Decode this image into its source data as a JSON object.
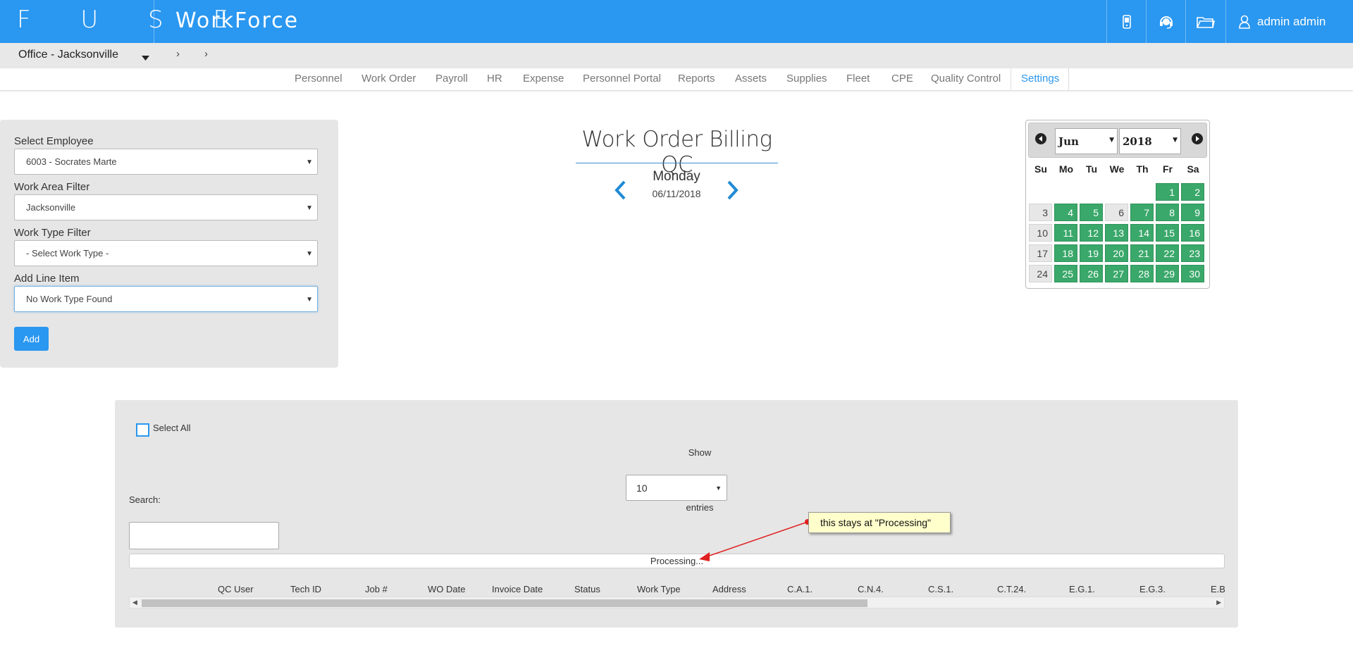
{
  "topbar": {
    "brand": "F U S E",
    "app_name": "WorkForce",
    "user_name": "admin admin",
    "icons": [
      "phone-icon",
      "headset-icon",
      "folder-icon",
      "user-icon"
    ],
    "color": "#2a97f0"
  },
  "officebar": {
    "office": "Office - Jacksonville",
    "crumbs": [
      "›",
      "›"
    ]
  },
  "nav": {
    "items": [
      "Personnel",
      "Work Order",
      "Payroll",
      "HR",
      "Expense",
      "Personnel Portal",
      "Reports",
      "Assets",
      "Supplies",
      "Fleet",
      "CPE",
      "Quality Control",
      "Settings"
    ],
    "active": "Settings"
  },
  "form": {
    "employee_label": "Select Employee",
    "employee_value": "6003 - Socrates Marte",
    "work_area_label": "Work Area Filter",
    "work_area_value": "Jacksonville",
    "work_type_label": "Work Type Filter",
    "work_type_value": "- Select Work Type -",
    "line_item_label": "Add Line Item",
    "line_item_value": "No Work Type Found",
    "add_label": "Add"
  },
  "header": {
    "title": "Work Order Billing QC",
    "day": "Monday",
    "date": "06/11/2018"
  },
  "calendar": {
    "month": "Jun",
    "year": "2018",
    "dow": [
      "Su",
      "Mo",
      "Tu",
      "We",
      "Th",
      "Fr",
      "Sa"
    ],
    "weeks": [
      [
        null,
        null,
        null,
        null,
        null,
        {
          "d": "1",
          "on": true
        },
        {
          "d": "2",
          "on": true
        }
      ],
      [
        {
          "d": "3",
          "on": false
        },
        {
          "d": "4",
          "on": true
        },
        {
          "d": "5",
          "on": true
        },
        {
          "d": "6",
          "on": false
        },
        {
          "d": "7",
          "on": true
        },
        {
          "d": "8",
          "on": true
        },
        {
          "d": "9",
          "on": true
        }
      ],
      [
        {
          "d": "10",
          "on": false
        },
        {
          "d": "11",
          "on": true
        },
        {
          "d": "12",
          "on": true
        },
        {
          "d": "13",
          "on": true
        },
        {
          "d": "14",
          "on": true
        },
        {
          "d": "15",
          "on": true
        },
        {
          "d": "16",
          "on": true
        }
      ],
      [
        {
          "d": "17",
          "on": false
        },
        {
          "d": "18",
          "on": true
        },
        {
          "d": "19",
          "on": true
        },
        {
          "d": "20",
          "on": true
        },
        {
          "d": "21",
          "on": true
        },
        {
          "d": "22",
          "on": true
        },
        {
          "d": "23",
          "on": true
        }
      ],
      [
        {
          "d": "24",
          "on": false
        },
        {
          "d": "25",
          "on": true
        },
        {
          "d": "26",
          "on": true
        },
        {
          "d": "27",
          "on": true
        },
        {
          "d": "28",
          "on": true
        },
        {
          "d": "29",
          "on": true
        },
        {
          "d": "30",
          "on": true
        }
      ]
    ],
    "active_color": "#3aa86a"
  },
  "table": {
    "select_all": "Select All",
    "show": "Show",
    "page_size": "10",
    "entries": "entries",
    "search_label": "Search:",
    "processing": "Processing...",
    "columns": [
      "QC User",
      "Tech ID",
      "Job #",
      "WO Date",
      "Invoice Date",
      "Status",
      "Work Type",
      "Address",
      "C.A.1.",
      "C.N.4.",
      "C.S.1.",
      "C.T.24.",
      "E.G.1.",
      "E.G.3.",
      "E.B."
    ]
  },
  "annotation": {
    "text": "this stays at \"Processing\"",
    "color": "#e02020"
  }
}
